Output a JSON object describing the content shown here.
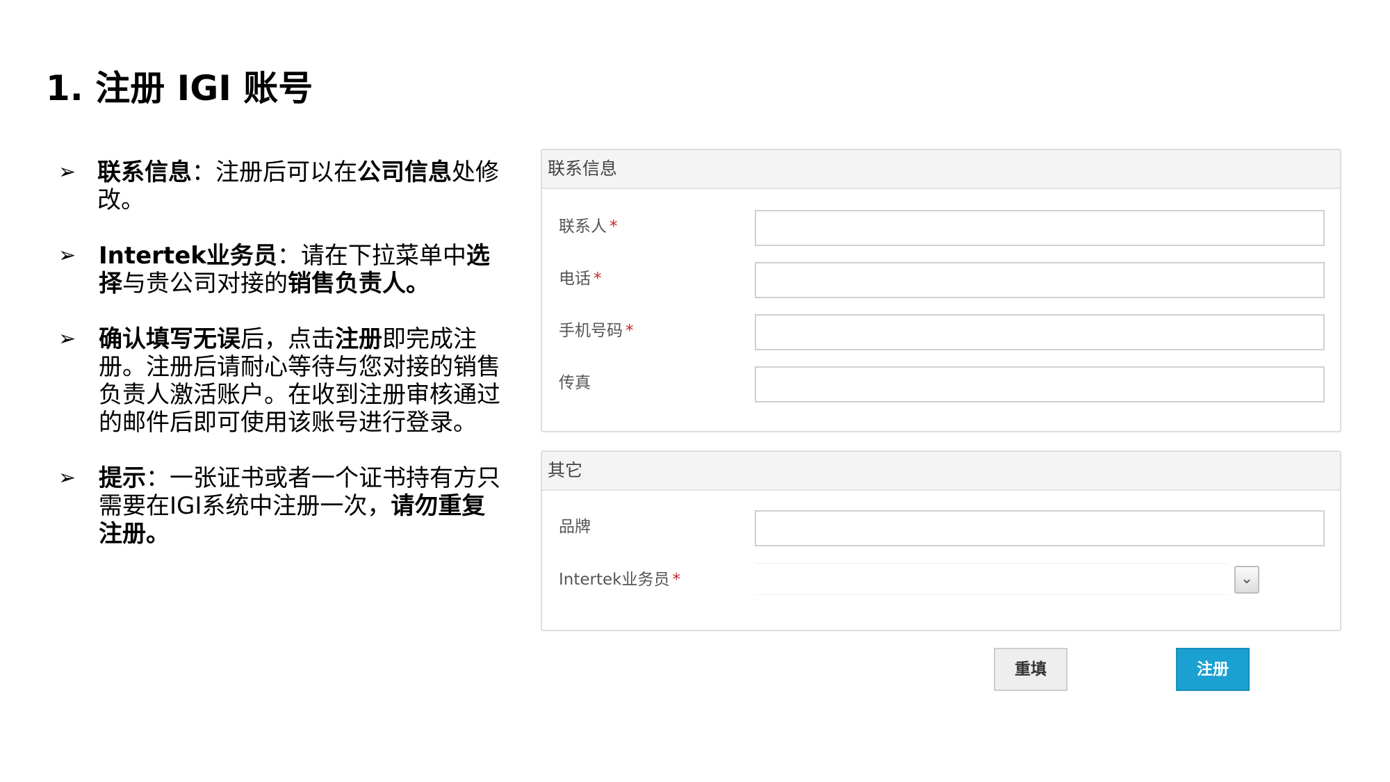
{
  "page": {
    "title": "1. 注册 IGI 账号"
  },
  "bullets": [
    {
      "parts": [
        {
          "t": "联系信息",
          "b": true
        },
        {
          "t": "：注册后可以在",
          "b": false
        },
        {
          "t": "公司信息",
          "b": true
        },
        {
          "t": "处修改。",
          "b": false
        }
      ]
    },
    {
      "parts": [
        {
          "t": "Intertek业务员",
          "b": true
        },
        {
          "t": "：请在下拉菜单中",
          "b": false
        },
        {
          "t": "选择",
          "b": true
        },
        {
          "t": "与贵公司对接的",
          "b": false
        },
        {
          "t": "销售负责人。",
          "b": true
        }
      ]
    },
    {
      "parts": [
        {
          "t": "确认填写无误",
          "b": true
        },
        {
          "t": "后，点击",
          "b": false
        },
        {
          "t": "注册",
          "b": true
        },
        {
          "t": "即完成注册。注册后请耐心等待与您对接的销售负责人激活账户。在收到注册审核通过的邮件后即可使用该账号进行登录。",
          "b": false
        }
      ]
    },
    {
      "parts": [
        {
          "t": "提示",
          "b": true
        },
        {
          "t": "：一张证书或者一个证书持有方只需要在IGI系统中注册一次，",
          "b": false
        },
        {
          "t": "请勿重复注册。",
          "b": true
        }
      ]
    }
  ],
  "bullet_marker": "➢",
  "form": {
    "contact_section": {
      "header": "联系信息",
      "fields": [
        {
          "label": "联系人",
          "required": "*",
          "value": ""
        },
        {
          "label": "电话",
          "required": "*",
          "value": ""
        },
        {
          "label": "手机号码",
          "required": "*",
          "value": ""
        },
        {
          "label": "传真",
          "required": "",
          "value": ""
        }
      ]
    },
    "other_section": {
      "header": "其它",
      "brand": {
        "label": "品牌",
        "required": "",
        "value": ""
      },
      "salesperson": {
        "label": "Intertek业务员",
        "required": "*",
        "selected": ""
      }
    },
    "select_arrow": "⌄",
    "buttons": {
      "reset": "重填",
      "register": "注册"
    }
  },
  "colors": {
    "accent": "#1ba1d1",
    "required": "#cc2222",
    "panel_border": "#dcdcdc"
  }
}
